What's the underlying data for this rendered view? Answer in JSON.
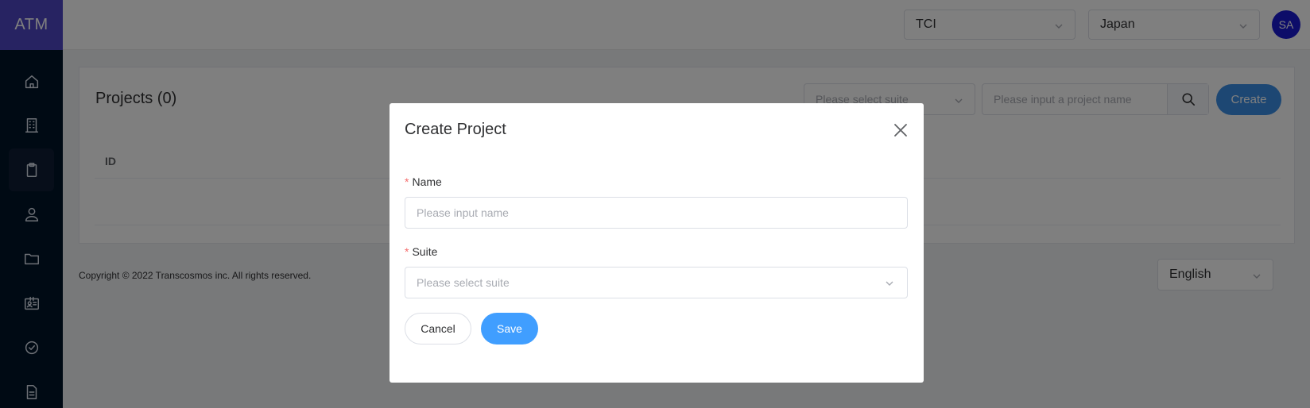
{
  "app": {
    "logo": "ATM"
  },
  "sidebar": {
    "items": [
      {
        "icon": "home-icon",
        "active": false
      },
      {
        "icon": "building-icon",
        "active": false
      },
      {
        "icon": "clipboard-icon",
        "active": true
      },
      {
        "icon": "user-icon",
        "active": false
      },
      {
        "icon": "folder-icon",
        "active": false
      },
      {
        "icon": "id-card-icon",
        "active": false
      },
      {
        "icon": "check-circle-icon",
        "active": false
      },
      {
        "icon": "document-icon",
        "active": false
      }
    ]
  },
  "header": {
    "company": "TCI",
    "country": "Japan",
    "avatar": "SA"
  },
  "main": {
    "title": "Projects (0)",
    "suite_placeholder": "Please select suite",
    "search_placeholder": "Please input a project name",
    "create_label": "Create",
    "table_headers": [
      "ID"
    ]
  },
  "footer": {
    "copyright": "Copyright © 2022 Transcosmos inc. All rights reserved.",
    "language": "English"
  },
  "modal": {
    "title": "Create Project",
    "name_label": "Name",
    "name_placeholder": "Please input name",
    "suite_label": "Suite",
    "suite_placeholder": "Please select suite",
    "cancel_label": "Cancel",
    "save_label": "Save"
  },
  "colors": {
    "sidebar_bg": "#001529",
    "logo_bg": "#4f46c5",
    "primary": "#409eff",
    "avatar_bg": "#1a1ad3",
    "required": "#f56c6c"
  }
}
